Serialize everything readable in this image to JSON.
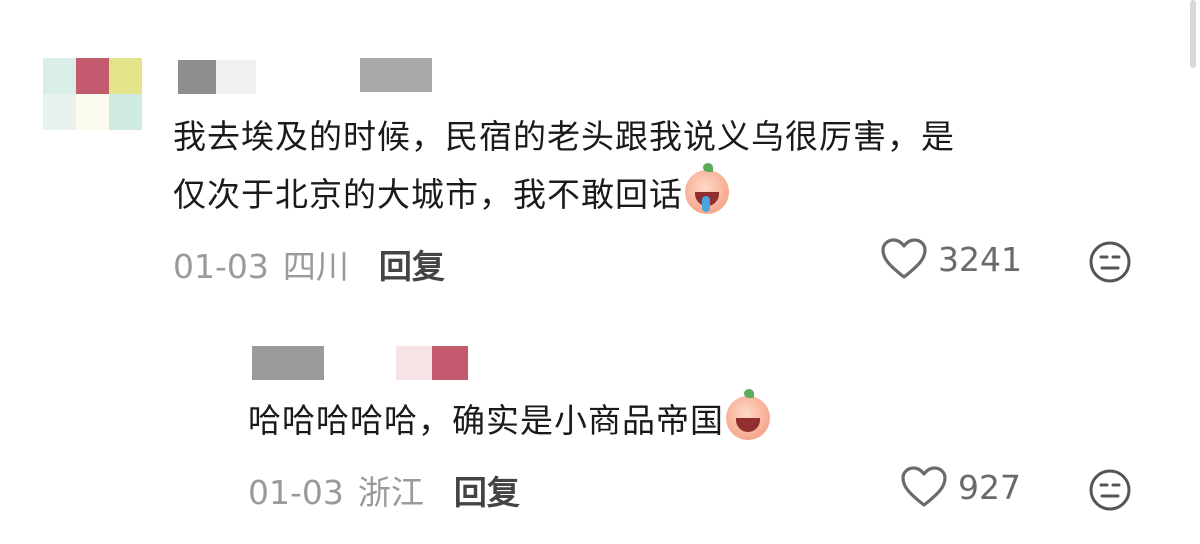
{
  "comments": [
    {
      "text_line1": "我去埃及的时候，民宿的老头跟我说义乌很厉害，是",
      "text_line2": "仅次于北京的大城市，我不敢回话",
      "emoji": "crying-laughing-peach-emoji",
      "date": "01-03",
      "location": "四川",
      "reply_label": "回复",
      "likes": "3241"
    },
    {
      "text_line1": "哈哈哈哈哈，确实是小商品帝国",
      "emoji": "laughing-peach-emoji",
      "date": "01-03",
      "location": "浙江",
      "reply_label": "回复",
      "likes": "927"
    }
  ],
  "colors": {
    "avatar_pink": "#c45a6e",
    "avatar_yellow": "#e3e38a",
    "avatar_mint": "#cfe9e3",
    "name_blur": "#9a9a9a"
  }
}
